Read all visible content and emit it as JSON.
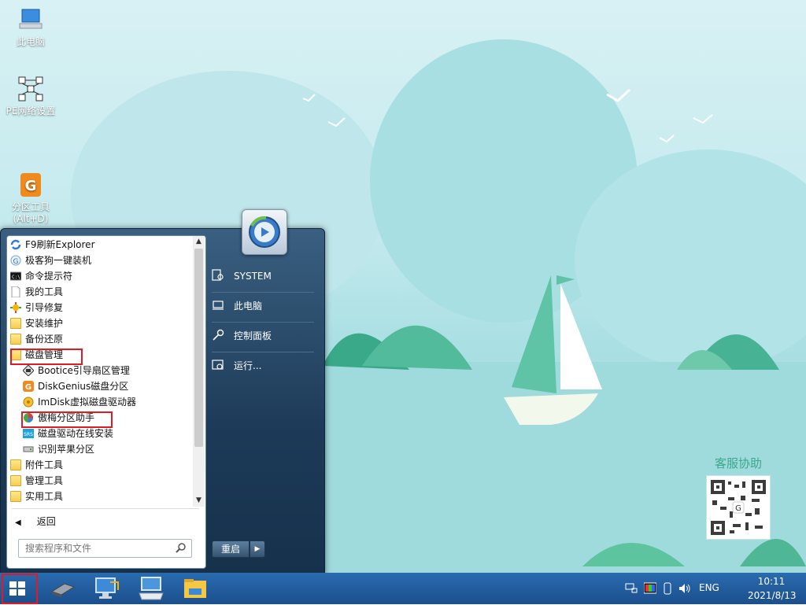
{
  "desktop": {
    "icons": [
      {
        "label": "此电脑"
      },
      {
        "label": "PE网络设置"
      },
      {
        "label": "分区工具\n(Alt+D)"
      }
    ],
    "qr_title": "客服协助"
  },
  "start_menu": {
    "programs": [
      {
        "label": "F9刷新Explorer",
        "icon": "refresh-icon"
      },
      {
        "label": "极客狗一键装机",
        "icon": "jikegou-icon"
      },
      {
        "label": "命令提示符",
        "icon": "cmd-icon"
      },
      {
        "label": "我的工具",
        "icon": "document-icon"
      },
      {
        "label": "引导修复",
        "icon": "repair-icon"
      },
      {
        "label": "安装维护",
        "icon": "folder-icon"
      },
      {
        "label": "备份还原",
        "icon": "folder-icon"
      },
      {
        "label": "磁盘管理",
        "icon": "folder-icon"
      },
      {
        "label": "Bootice引导扇区管理",
        "icon": "bootice-icon"
      },
      {
        "label": "DiskGenius磁盘分区",
        "icon": "diskgenius-icon"
      },
      {
        "label": "ImDisk虚拟磁盘驱动器",
        "icon": "imdisk-icon"
      },
      {
        "label": "傲梅分区助手",
        "icon": "aomei-icon"
      },
      {
        "label": "磁盘驱动在线安装",
        "icon": "driver-icon"
      },
      {
        "label": "识别苹果分区",
        "icon": "apple-partition-icon"
      },
      {
        "label": "附件工具",
        "icon": "folder-icon"
      },
      {
        "label": "管理工具",
        "icon": "folder-icon"
      },
      {
        "label": "实用工具",
        "icon": "folder-icon"
      }
    ],
    "back_label": "返回",
    "search_placeholder": "搜索程序和文件",
    "right_items": [
      {
        "label": "SYSTEM",
        "icon": "user-icon"
      },
      {
        "label": "此电脑",
        "icon": "computer-icon"
      },
      {
        "label": "控制面板",
        "icon": "wrench-icon"
      },
      {
        "label": "运行...",
        "icon": "run-icon"
      }
    ],
    "restart_label": "重启"
  },
  "taskbar": {
    "lang": "ENG",
    "time": "10:11",
    "date": "2021/8/13"
  },
  "colors": {
    "highlight": "#e21a23",
    "taskbar": "#1f5c9e"
  }
}
